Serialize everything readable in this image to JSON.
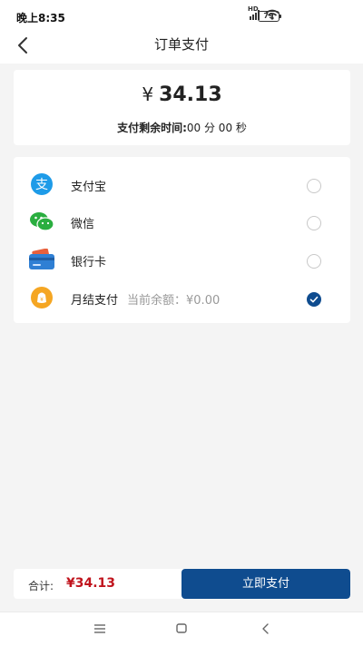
{
  "status_bar": {
    "time": "晚上8:35",
    "battery": "79"
  },
  "header": {
    "title": "订单支付"
  },
  "amount_card": {
    "currency_symbol": "¥",
    "amount": "34.13",
    "countdown_label": "支付剩余时间:",
    "countdown_value": "00 分 00 秒"
  },
  "payment_methods": [
    {
      "label": "支付宝",
      "icon": "alipay-icon",
      "selected": false
    },
    {
      "label": "微信",
      "icon": "wechat-icon",
      "selected": false
    },
    {
      "label": "银行卡",
      "icon": "bank-card-icon",
      "selected": false
    },
    {
      "label": "月结支付",
      "sub_label": "当前余额：¥0.00",
      "icon": "monthly-pay-icon",
      "selected": true
    }
  ],
  "bottom_bar": {
    "total_label": "合计:",
    "total_value": "¥34.13",
    "pay_button": "立即支付"
  },
  "colors": {
    "accent": "#0f4c8f",
    "price_red": "#c0141d",
    "alipay_blue": "#1e9be8",
    "wechat_green": "#2aae3f",
    "monthly_orange": "#f5a623"
  }
}
